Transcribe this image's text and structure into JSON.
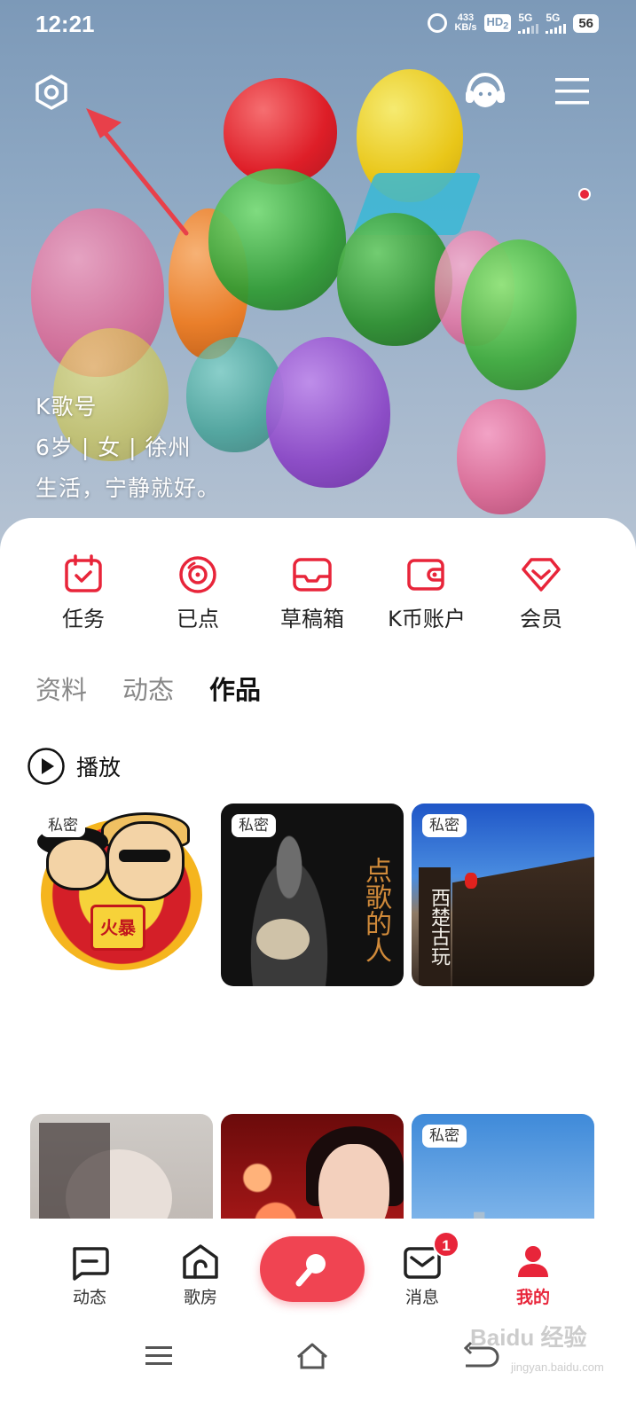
{
  "status_bar": {
    "time": "12:21",
    "net_speed_value": "433",
    "net_speed_unit": "KB/s",
    "hd_label": "HD",
    "hd_sub": "2",
    "signal1": "5G",
    "signal2": "5G",
    "battery": "56"
  },
  "header": {
    "settings_icon": "gear-icon",
    "service_icon": "headset-icon",
    "menu_icon": "hamburger-icon"
  },
  "profile": {
    "k_id_label": "K歌号",
    "age_gender_city": "6岁 | 女 | 徐州",
    "bio": "生活，宁静就好。"
  },
  "quick_actions": [
    {
      "label": "任务",
      "icon": "calendar-check-icon"
    },
    {
      "label": "已点",
      "icon": "disc-icon"
    },
    {
      "label": "草稿箱",
      "icon": "inbox-icon"
    },
    {
      "label": "K币账户",
      "icon": "wallet-icon"
    },
    {
      "label": "会员",
      "icon": "diamond-icon"
    }
  ],
  "tabs": [
    "资料",
    "动态",
    "作品"
  ],
  "active_tab": "作品",
  "play_label": "播放",
  "works": [
    {
      "badge": "私密",
      "sign_text": "火暴"
    },
    {
      "badge": "私密",
      "art_text": "点歌的人"
    },
    {
      "badge": "私密",
      "art_text": "西楚古玩"
    },
    {
      "badge": ""
    },
    {
      "badge": ""
    },
    {
      "badge": "私密"
    }
  ],
  "bottom_nav": [
    {
      "label": "动态",
      "icon": "chat-icon"
    },
    {
      "label": "歌房",
      "icon": "house-icon"
    },
    {
      "label": "",
      "icon": "microphone-icon"
    },
    {
      "label": "消息",
      "icon": "mail-icon",
      "badge": "1"
    },
    {
      "label": "我的",
      "icon": "person-icon"
    }
  ],
  "colors": {
    "accent": "#e8253a",
    "sing_button": "#f04452"
  },
  "watermark": {
    "main": "Baidu 经验",
    "sub": "jingyan.baidu.com"
  }
}
